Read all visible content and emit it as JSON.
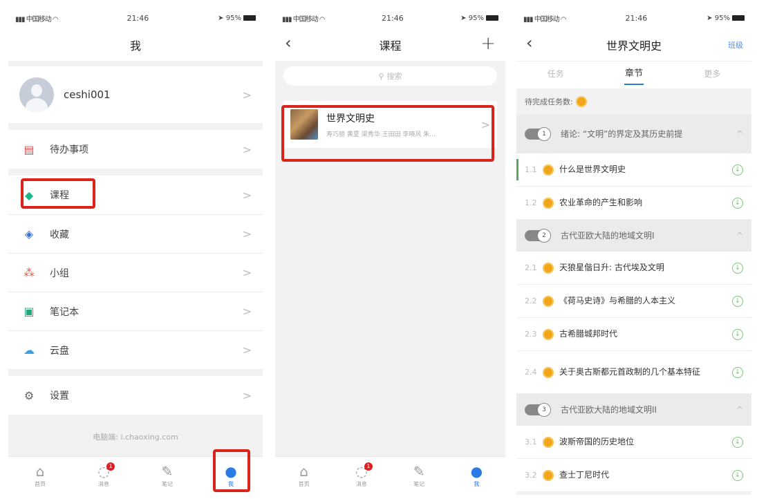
{
  "status": {
    "carrier": "中国移动",
    "time": "21:46",
    "battery": "95%"
  },
  "page1": {
    "title": "我",
    "username": "ceshi001",
    "menu": [
      {
        "label": "待办事项",
        "icon": "todo-icon",
        "color": "#e05555"
      },
      {
        "label": "课程",
        "icon": "graduation-cap-icon",
        "color": "#1fb58f"
      },
      {
        "label": "收藏",
        "icon": "stack-icon",
        "color": "#2f6fd6"
      },
      {
        "label": "小组",
        "icon": "group-icon",
        "color": "#e55a4a"
      },
      {
        "label": "笔记本",
        "icon": "notebook-icon",
        "color": "#20a67a"
      },
      {
        "label": "云盘",
        "icon": "cloud-icon",
        "color": "#3aa0e8"
      }
    ],
    "settings_label": "设置",
    "footer": "电脑端: i.chaoxing.com"
  },
  "tabbar": [
    {
      "label": "首页",
      "icon": "home-icon"
    },
    {
      "label": "消息",
      "icon": "message-icon",
      "badge": "1"
    },
    {
      "label": "笔记",
      "icon": "note-icon"
    },
    {
      "label": "我",
      "icon": "user-icon"
    }
  ],
  "page2": {
    "title": "课程",
    "search_placeholder": "搜索",
    "course": {
      "title": "世界文明史",
      "teachers": "寿巧丽 黄夏 梁秀华 王田田 李晓风 朱..."
    }
  },
  "page3": {
    "title": "世界文明史",
    "right_action": "班级",
    "tabs": [
      "任务",
      "章节",
      "更多"
    ],
    "pending_label": "待完成任务数:",
    "chapters": [
      {
        "num": "1",
        "title": "绪论: “文明”的界定及其历史前提",
        "lessons": [
          {
            "num": "1.1",
            "title": "什么是世界文明史"
          },
          {
            "num": "1.2",
            "title": "农业革命的产生和影响"
          }
        ]
      },
      {
        "num": "2",
        "title": "古代亚欧大陆的地域文明I",
        "lessons": [
          {
            "num": "2.1",
            "title": "天狼星偕日升: 古代埃及文明"
          },
          {
            "num": "2.2",
            "title": "《荷马史诗》与希腊的人本主义"
          },
          {
            "num": "2.3",
            "title": "古希腊城邦时代"
          },
          {
            "num": "2.4",
            "title": "关于奥古斯都元首政制的几个基本特征"
          }
        ]
      },
      {
        "num": "3",
        "title": "古代亚欧大陆的地域文明II",
        "lessons": [
          {
            "num": "3.1",
            "title": "波斯帝国的历史地位"
          },
          {
            "num": "3.2",
            "title": "查士丁尼时代"
          }
        ]
      }
    ]
  }
}
